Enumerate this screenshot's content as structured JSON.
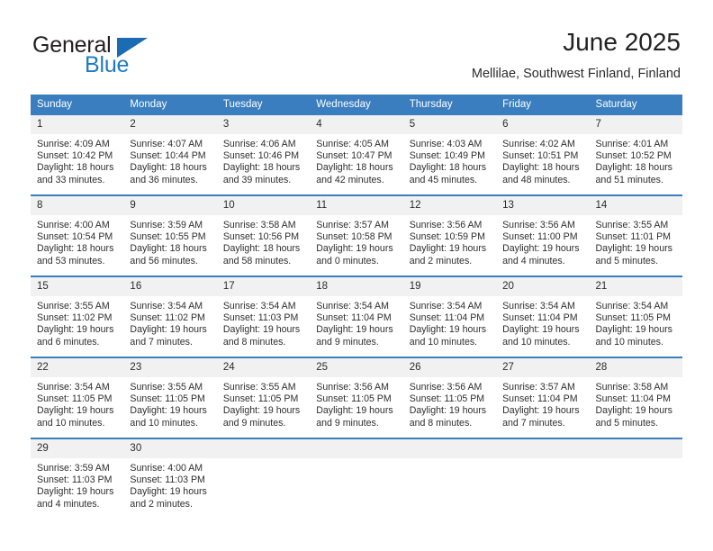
{
  "logo": {
    "word_top": "General",
    "word_bottom": "Blue",
    "triangle_color": "#1b6cb3",
    "text_color": "#231f20",
    "blue_color": "#1f7bc1"
  },
  "header": {
    "title": "June 2025",
    "subtitle": "Mellilae, Southwest Finland, Finland"
  },
  "theme": {
    "header_blue": "#3a7ebf",
    "daynum_band": "#f1f1f1",
    "text": "#2e2e2e"
  },
  "weekdays": [
    "Sunday",
    "Monday",
    "Tuesday",
    "Wednesday",
    "Thursday",
    "Friday",
    "Saturday"
  ],
  "weeks": [
    [
      {
        "day": "1",
        "sunrise": "Sunrise: 4:09 AM",
        "sunset": "Sunset: 10:42 PM",
        "daylight1": "Daylight: 18 hours",
        "daylight2": "and 33 minutes."
      },
      {
        "day": "2",
        "sunrise": "Sunrise: 4:07 AM",
        "sunset": "Sunset: 10:44 PM",
        "daylight1": "Daylight: 18 hours",
        "daylight2": "and 36 minutes."
      },
      {
        "day": "3",
        "sunrise": "Sunrise: 4:06 AM",
        "sunset": "Sunset: 10:46 PM",
        "daylight1": "Daylight: 18 hours",
        "daylight2": "and 39 minutes."
      },
      {
        "day": "4",
        "sunrise": "Sunrise: 4:05 AM",
        "sunset": "Sunset: 10:47 PM",
        "daylight1": "Daylight: 18 hours",
        "daylight2": "and 42 minutes."
      },
      {
        "day": "5",
        "sunrise": "Sunrise: 4:03 AM",
        "sunset": "Sunset: 10:49 PM",
        "daylight1": "Daylight: 18 hours",
        "daylight2": "and 45 minutes."
      },
      {
        "day": "6",
        "sunrise": "Sunrise: 4:02 AM",
        "sunset": "Sunset: 10:51 PM",
        "daylight1": "Daylight: 18 hours",
        "daylight2": "and 48 minutes."
      },
      {
        "day": "7",
        "sunrise": "Sunrise: 4:01 AM",
        "sunset": "Sunset: 10:52 PM",
        "daylight1": "Daylight: 18 hours",
        "daylight2": "and 51 minutes."
      }
    ],
    [
      {
        "day": "8",
        "sunrise": "Sunrise: 4:00 AM",
        "sunset": "Sunset: 10:54 PM",
        "daylight1": "Daylight: 18 hours",
        "daylight2": "and 53 minutes."
      },
      {
        "day": "9",
        "sunrise": "Sunrise: 3:59 AM",
        "sunset": "Sunset: 10:55 PM",
        "daylight1": "Daylight: 18 hours",
        "daylight2": "and 56 minutes."
      },
      {
        "day": "10",
        "sunrise": "Sunrise: 3:58 AM",
        "sunset": "Sunset: 10:56 PM",
        "daylight1": "Daylight: 18 hours",
        "daylight2": "and 58 minutes."
      },
      {
        "day": "11",
        "sunrise": "Sunrise: 3:57 AM",
        "sunset": "Sunset: 10:58 PM",
        "daylight1": "Daylight: 19 hours",
        "daylight2": "and 0 minutes."
      },
      {
        "day": "12",
        "sunrise": "Sunrise: 3:56 AM",
        "sunset": "Sunset: 10:59 PM",
        "daylight1": "Daylight: 19 hours",
        "daylight2": "and 2 minutes."
      },
      {
        "day": "13",
        "sunrise": "Sunrise: 3:56 AM",
        "sunset": "Sunset: 11:00 PM",
        "daylight1": "Daylight: 19 hours",
        "daylight2": "and 4 minutes."
      },
      {
        "day": "14",
        "sunrise": "Sunrise: 3:55 AM",
        "sunset": "Sunset: 11:01 PM",
        "daylight1": "Daylight: 19 hours",
        "daylight2": "and 5 minutes."
      }
    ],
    [
      {
        "day": "15",
        "sunrise": "Sunrise: 3:55 AM",
        "sunset": "Sunset: 11:02 PM",
        "daylight1": "Daylight: 19 hours",
        "daylight2": "and 6 minutes."
      },
      {
        "day": "16",
        "sunrise": "Sunrise: 3:54 AM",
        "sunset": "Sunset: 11:02 PM",
        "daylight1": "Daylight: 19 hours",
        "daylight2": "and 7 minutes."
      },
      {
        "day": "17",
        "sunrise": "Sunrise: 3:54 AM",
        "sunset": "Sunset: 11:03 PM",
        "daylight1": "Daylight: 19 hours",
        "daylight2": "and 8 minutes."
      },
      {
        "day": "18",
        "sunrise": "Sunrise: 3:54 AM",
        "sunset": "Sunset: 11:04 PM",
        "daylight1": "Daylight: 19 hours",
        "daylight2": "and 9 minutes."
      },
      {
        "day": "19",
        "sunrise": "Sunrise: 3:54 AM",
        "sunset": "Sunset: 11:04 PM",
        "daylight1": "Daylight: 19 hours",
        "daylight2": "and 10 minutes."
      },
      {
        "day": "20",
        "sunrise": "Sunrise: 3:54 AM",
        "sunset": "Sunset: 11:04 PM",
        "daylight1": "Daylight: 19 hours",
        "daylight2": "and 10 minutes."
      },
      {
        "day": "21",
        "sunrise": "Sunrise: 3:54 AM",
        "sunset": "Sunset: 11:05 PM",
        "daylight1": "Daylight: 19 hours",
        "daylight2": "and 10 minutes."
      }
    ],
    [
      {
        "day": "22",
        "sunrise": "Sunrise: 3:54 AM",
        "sunset": "Sunset: 11:05 PM",
        "daylight1": "Daylight: 19 hours",
        "daylight2": "and 10 minutes."
      },
      {
        "day": "23",
        "sunrise": "Sunrise: 3:55 AM",
        "sunset": "Sunset: 11:05 PM",
        "daylight1": "Daylight: 19 hours",
        "daylight2": "and 10 minutes."
      },
      {
        "day": "24",
        "sunrise": "Sunrise: 3:55 AM",
        "sunset": "Sunset: 11:05 PM",
        "daylight1": "Daylight: 19 hours",
        "daylight2": "and 9 minutes."
      },
      {
        "day": "25",
        "sunrise": "Sunrise: 3:56 AM",
        "sunset": "Sunset: 11:05 PM",
        "daylight1": "Daylight: 19 hours",
        "daylight2": "and 9 minutes."
      },
      {
        "day": "26",
        "sunrise": "Sunrise: 3:56 AM",
        "sunset": "Sunset: 11:05 PM",
        "daylight1": "Daylight: 19 hours",
        "daylight2": "and 8 minutes."
      },
      {
        "day": "27",
        "sunrise": "Sunrise: 3:57 AM",
        "sunset": "Sunset: 11:04 PM",
        "daylight1": "Daylight: 19 hours",
        "daylight2": "and 7 minutes."
      },
      {
        "day": "28",
        "sunrise": "Sunrise: 3:58 AM",
        "sunset": "Sunset: 11:04 PM",
        "daylight1": "Daylight: 19 hours",
        "daylight2": "and 5 minutes."
      }
    ],
    [
      {
        "day": "29",
        "sunrise": "Sunrise: 3:59 AM",
        "sunset": "Sunset: 11:03 PM",
        "daylight1": "Daylight: 19 hours",
        "daylight2": "and 4 minutes."
      },
      {
        "day": "30",
        "sunrise": "Sunrise: 4:00 AM",
        "sunset": "Sunset: 11:03 PM",
        "daylight1": "Daylight: 19 hours",
        "daylight2": "and 2 minutes."
      },
      {
        "day": "",
        "sunrise": "",
        "sunset": "",
        "daylight1": "",
        "daylight2": ""
      },
      {
        "day": "",
        "sunrise": "",
        "sunset": "",
        "daylight1": "",
        "daylight2": ""
      },
      {
        "day": "",
        "sunrise": "",
        "sunset": "",
        "daylight1": "",
        "daylight2": ""
      },
      {
        "day": "",
        "sunrise": "",
        "sunset": "",
        "daylight1": "",
        "daylight2": ""
      },
      {
        "day": "",
        "sunrise": "",
        "sunset": "",
        "daylight1": "",
        "daylight2": ""
      }
    ]
  ]
}
